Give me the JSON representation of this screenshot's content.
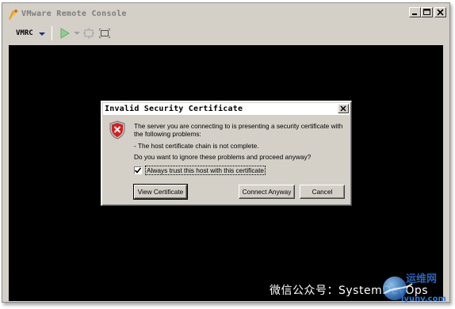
{
  "window": {
    "title": "VMware Remote Console",
    "controls": [
      "minimize",
      "maximize",
      "close"
    ]
  },
  "toolbar": {
    "vm_menu_label": "VMRC",
    "icons": [
      "play-icon",
      "dropdown-arrow-icon",
      "devices-icon",
      "fullscreen-icon"
    ]
  },
  "dialog": {
    "title": "Invalid Security Certificate",
    "icon": "shield-error-icon",
    "message_1": "The server you are connecting to is presenting a security certificate with the following problems:",
    "message_2": "- The host certificate chain is not complete.",
    "message_3": "Do you want to ignore these problems and proceed anyway?",
    "checkbox": {
      "label": "Always trust this host with this certificate",
      "checked": true
    },
    "buttons": {
      "view": "View Certificate",
      "connect": "Connect Anyway",
      "cancel": "Cancel"
    }
  },
  "watermark": {
    "text": "微信公众号：SystemDevOps",
    "logo_cn": "运维网",
    "logo_en": "iyunv.com"
  }
}
